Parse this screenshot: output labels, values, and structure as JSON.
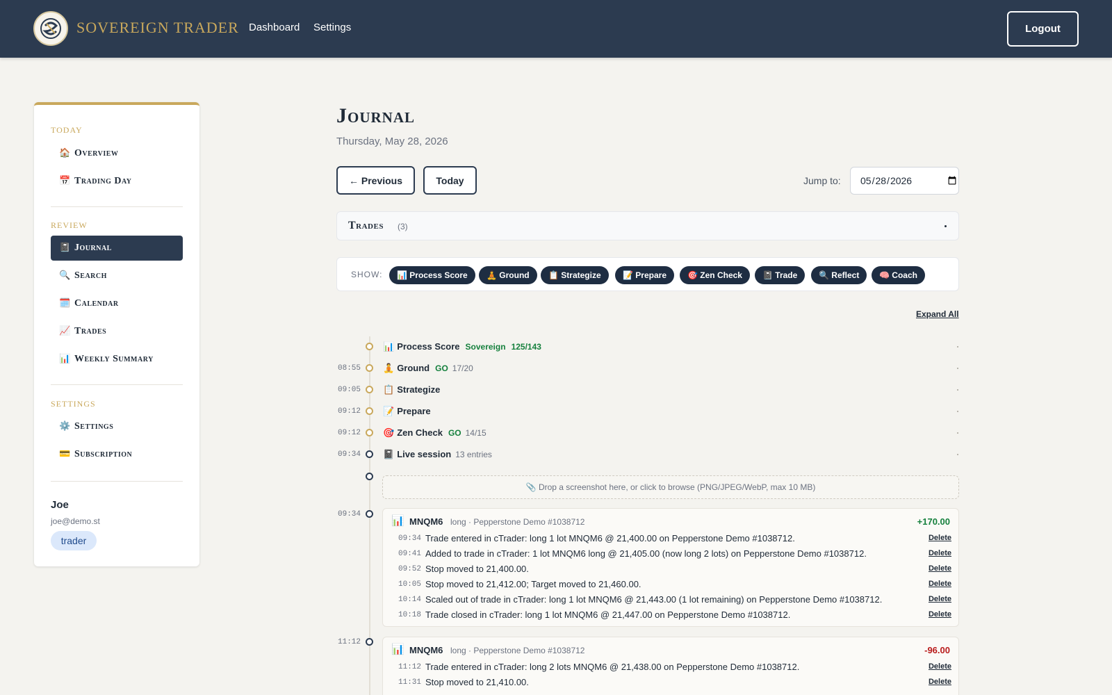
{
  "header": {
    "brand": "SOVEREIGN TRADER",
    "nav": [
      "Dashboard",
      "Settings"
    ],
    "logout_label": "Logout"
  },
  "sidebar": {
    "sections": [
      "TODAY",
      "REVIEW",
      "SETTINGS"
    ],
    "items": [
      {
        "icon": "🏠",
        "label": "Overview"
      },
      {
        "icon": "📅",
        "label": "Trading Day"
      },
      {
        "icon": "📓",
        "label": "Journal"
      },
      {
        "icon": "🔍",
        "label": "Search"
      },
      {
        "icon": "🗓️",
        "label": "Calendar"
      },
      {
        "icon": "📈",
        "label": "Trades"
      },
      {
        "icon": "📊",
        "label": "Weekly Summary"
      },
      {
        "icon": "⚙️",
        "label": "Settings"
      },
      {
        "icon": "💳",
        "label": "Subscription"
      }
    ],
    "active_item": "Journal",
    "user": {
      "name": "Joe",
      "email": "joe@demo.st",
      "role": "trader"
    }
  },
  "main": {
    "title": "Journal",
    "date": "Thursday, May 28, 2026",
    "prev_label": "← Previous",
    "today_label": "Today",
    "jump_label": "Jump to:",
    "jump_value": "05/28/2026",
    "trades_title": "Trades",
    "trades_count": "(3)",
    "show_label": "SHOW:",
    "chips": [
      {
        "icon": "📊",
        "label": "Process Score"
      },
      {
        "icon": "🧘",
        "label": "Ground"
      },
      {
        "icon": "📋",
        "label": "Strategize"
      },
      {
        "icon": "📝",
        "label": "Prepare"
      },
      {
        "icon": "🎯",
        "label": "Zen Check"
      },
      {
        "icon": "📓",
        "label": "Trade"
      },
      {
        "icon": "🔍",
        "label": "Reflect"
      },
      {
        "icon": "🧠",
        "label": "Coach"
      }
    ],
    "expand_all": "Expand All"
  },
  "timeline": [
    {
      "time": "",
      "icon": "📊",
      "label": "Process Score",
      "tag": "Sovereign",
      "tag2": "125/143",
      "sub": ""
    },
    {
      "time": "08:55",
      "icon": "🧘",
      "label": "Ground",
      "tag": "GO",
      "tag2": "",
      "sub": "17/20"
    },
    {
      "time": "09:05",
      "icon": "📋",
      "label": "Strategize",
      "tag": "",
      "tag2": "",
      "sub": ""
    },
    {
      "time": "09:12",
      "icon": "📝",
      "label": "Prepare",
      "tag": "",
      "tag2": "",
      "sub": ""
    },
    {
      "time": "09:12",
      "icon": "🎯",
      "label": "Zen Check",
      "tag": "GO",
      "tag2": "",
      "sub": "14/15"
    },
    {
      "time": "09:34",
      "icon": "📓",
      "label": "Live session",
      "tag": "",
      "tag2": "",
      "sub": "13 entries"
    }
  ],
  "dropzone_text": "📎 Drop a screenshot here, or click to browse (PNG/JPEG/WebP, max 10 MB)",
  "trades": [
    {
      "time": "09:34",
      "icon": "📊",
      "symbol": "MNQM6",
      "meta": "long · Pepperstone Demo #1038712",
      "pnl": "+170.00",
      "events": [
        {
          "time": "09:34",
          "text": "Trade entered in cTrader: long 1 lot MNQM6 @ 21,400.00 on Pepperstone Demo #1038712."
        },
        {
          "time": "09:41",
          "text": "Added to trade in cTrader: 1 lot MNQM6 long @ 21,405.00 (now long 2 lots) on Pepperstone Demo #1038712."
        },
        {
          "time": "09:52",
          "text": "Stop moved to 21,400.00."
        },
        {
          "time": "10:05",
          "text": "Stop moved to 21,412.00; Target moved to 21,460.00."
        },
        {
          "time": "10:14",
          "text": "Scaled out of trade in cTrader: long 1 lot MNQM6 @ 21,443.00 (1 lot remaining) on Pepperstone Demo #1038712."
        },
        {
          "time": "10:18",
          "text": "Trade closed in cTrader: long 1 lot MNQM6 @ 21,447.00 on Pepperstone Demo #1038712."
        }
      ]
    },
    {
      "time": "11:12",
      "icon": "📊",
      "symbol": "MNQM6",
      "meta": "long · Pepperstone Demo #1038712",
      "pnl": "-96.00",
      "events": [
        {
          "time": "11:12",
          "text": "Trade entered in cTrader: long 2 lots MNQM6 @ 21,438.00 on Pepperstone Demo #1038712."
        },
        {
          "time": "11:31",
          "text": "Stop moved to 21,410.00."
        }
      ]
    }
  ],
  "delete_label": "Delete",
  "colors": {
    "navy": "#2c3b50",
    "gold": "#c9a85c",
    "green": "#15803d",
    "red": "#b91c1c"
  }
}
